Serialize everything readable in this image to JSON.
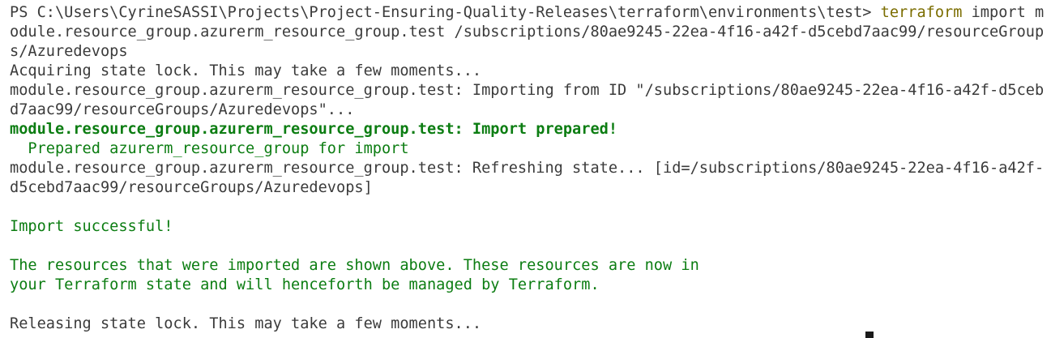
{
  "terminal": {
    "prompt": "PS C:\\Users\\CyrineSASSI\\Projects\\Project-Ensuring-Quality-Releases\\terraform\\environments\\test> ",
    "command_name": "terraform",
    "command_args_1": " import m",
    "command_args_2": "odule.resource_group.azurerm_resource_group.test /subscriptions/80ae9245-22ea-4f16-a42f-d5cebd7aac99/resourceGroup",
    "command_args_3": "s/Azuredevops",
    "acquiring_lock": "Acquiring state lock. This may take a few moments...",
    "importing_1": "module.resource_group.azurerm_resource_group.test: Importing from ID \"/subscriptions/80ae9245-22ea-4f16-a42f-d5ceb",
    "importing_2": "d7aac99/resourceGroups/Azuredevops\"...",
    "import_prepared": "module.resource_group.azurerm_resource_group.test: Import prepared!",
    "prepared_detail": "  Prepared azurerm_resource_group for import",
    "refreshing_1": "module.resource_group.azurerm_resource_group.test: Refreshing state... [id=/subscriptions/80ae9245-22ea-4f16-a42f-",
    "refreshing_2": "d5cebd7aac99/resourceGroups/Azuredevops]",
    "import_successful": "Import successful!",
    "resources_msg_1": "The resources that were imported are shown above. These resources are now in",
    "resources_msg_2": "your Terraform state and will henceforth be managed by Terraform.",
    "releasing_lock": "Releasing state lock. This may take a few moments..."
  },
  "colors": {
    "default_text": "#3b3b3b",
    "success_green": "#0c7d12",
    "command_yellow": "#7b6d00",
    "background": "#ffffff"
  }
}
